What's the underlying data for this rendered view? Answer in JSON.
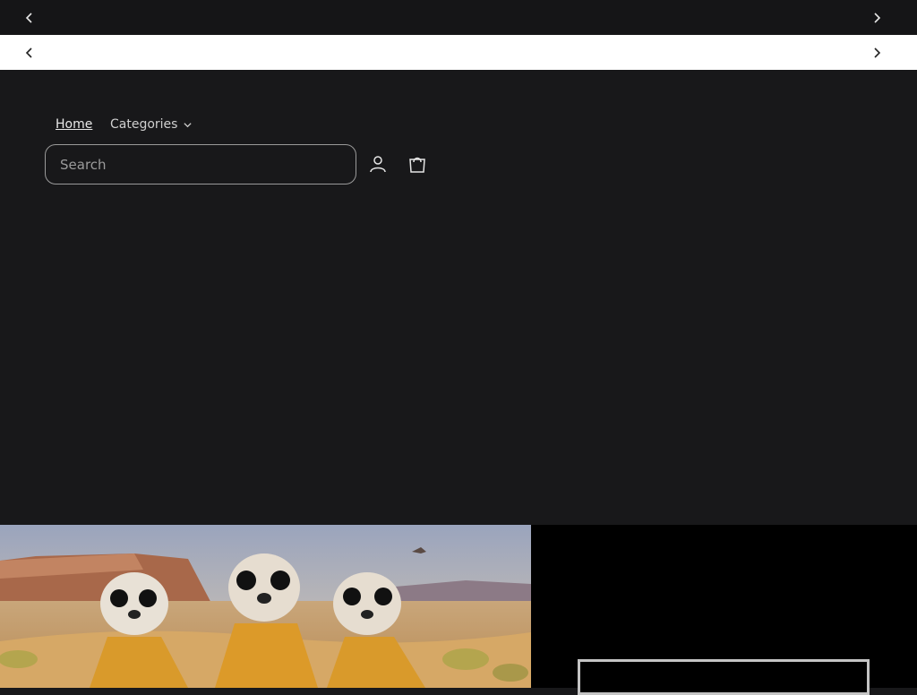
{
  "announcement_bar": {
    "prev_icon": "chevron-left-icon",
    "next_icon": "chevron-right-icon"
  },
  "secondary_bar": {
    "prev_icon": "chevron-left-icon",
    "next_icon": "chevron-right-icon"
  },
  "nav": {
    "home_label": "Home",
    "categories_label": "Categories"
  },
  "search": {
    "placeholder": "Search"
  },
  "header_icons": {
    "account": "account-icon",
    "cart": "cart-icon"
  },
  "colors": {
    "page_background": "#18181a",
    "top_bar": "#151517",
    "second_bar": "#ffffff",
    "hero_panel": "#000000"
  }
}
